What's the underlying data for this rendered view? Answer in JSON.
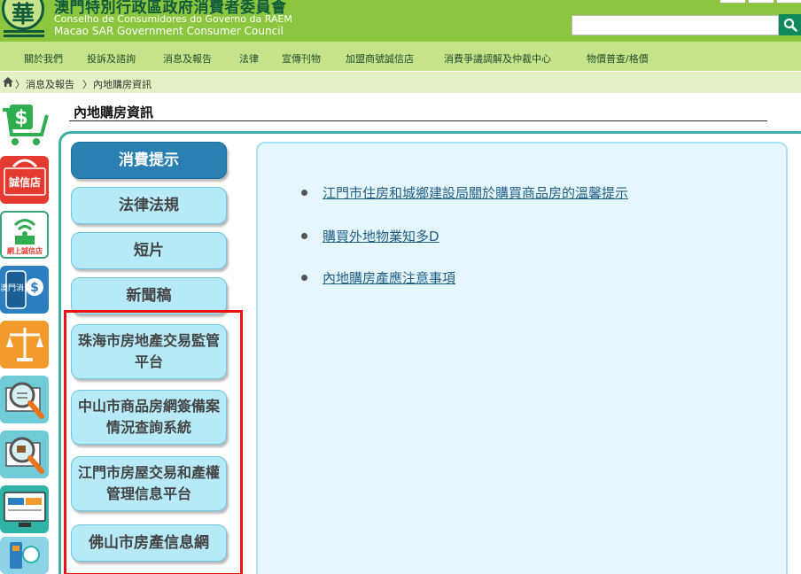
{
  "header": {
    "org_zh": "澳門特別行政區政府消費者委員會",
    "org_pt": "Conselho de Consumidores do Governo da RAEM",
    "org_en": "Macao SAR Government Consumer Council",
    "logo_char": "華",
    "search_placeholder": ""
  },
  "menu": {
    "items": [
      "關於我們",
      "投訴及諮詢",
      "消息及報告",
      "法律",
      "宣傳刊物",
      "加盟商號誠信店",
      "消費爭議調解及仲裁中心",
      "物價普查/格價"
    ]
  },
  "breadcrumb": {
    "items": [
      "消息及報告",
      "內地購房資訊"
    ],
    "separator": "〉"
  },
  "page": {
    "title": "內地購房資訊"
  },
  "tabs": [
    {
      "label": "消費提示",
      "active": true
    },
    {
      "label": "法律法規",
      "active": false
    },
    {
      "label": "短片",
      "active": false
    },
    {
      "label": "新聞稿",
      "active": false
    },
    {
      "label": "珠海市房地產交易監管平台",
      "active": false
    },
    {
      "label": "中山市商品房網簽備案情況查詢系統",
      "active": false
    },
    {
      "label": "江門市房屋交易和產權管理信息平台",
      "active": false
    },
    {
      "label": "佛山市房產信息網",
      "active": false
    }
  ],
  "links": [
    "江門市住房和城鄉建設局關於購買商品房的溫馨提示",
    "購買外地物業知多D",
    "內地購房產應注意事項"
  ],
  "side_icons": [
    {
      "name": "shopping-cart-icon",
      "label": ""
    },
    {
      "name": "honest-shop-icon",
      "label": "誠信店"
    },
    {
      "name": "online-honest-shop-icon",
      "label": "網上誠信店"
    },
    {
      "name": "macao-consumer-app-icon",
      "label": "澳門消費"
    },
    {
      "name": "scale-justice-icon",
      "label": ""
    },
    {
      "name": "magnifier-price-icon",
      "label": ""
    },
    {
      "name": "magnifier-hand-icon",
      "label": ""
    },
    {
      "name": "computer-screen-icon",
      "label": ""
    },
    {
      "name": "mobile-app-icon",
      "label": ""
    }
  ],
  "colors": {
    "header_green": "#8cc63f",
    "menu_green": "#c6e38a",
    "breadcrumb_green": "#e3f1c5",
    "tab_active": "#2a7fb3",
    "tab_inactive": "#b7eaf7",
    "panel_border": "#3fb0a9",
    "highlight_red": "#ee1111"
  }
}
